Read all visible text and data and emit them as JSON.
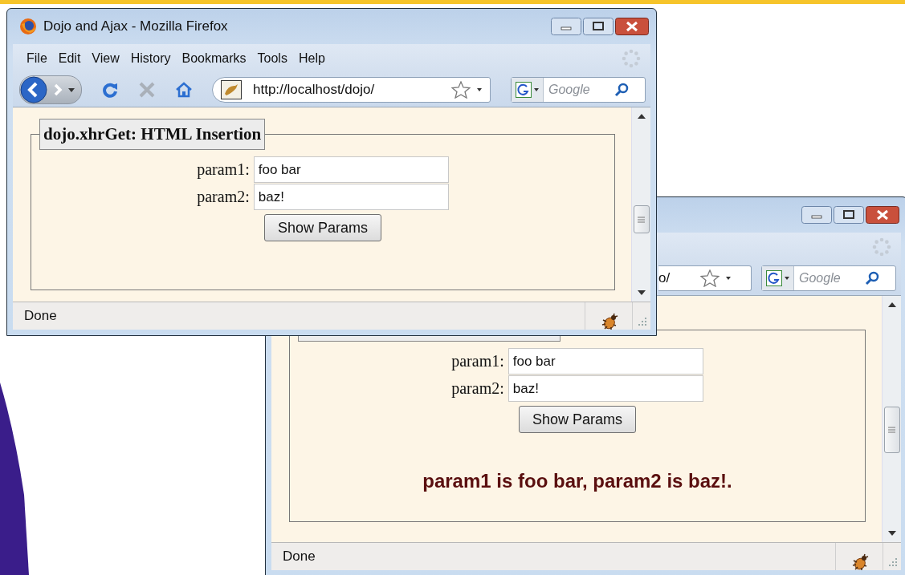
{
  "windows": [
    {
      "title": "Dojo and Ajax - Mozilla Firefox",
      "menu": [
        "File",
        "Edit",
        "View",
        "History",
        "Bookmarks",
        "Tools",
        "Help"
      ],
      "url": "http://localhost/dojo/",
      "search": {
        "placeholder": "Google"
      },
      "legend": "dojo.xhrGet: HTML Insertion",
      "fields": [
        {
          "label": "param1:",
          "value": "foo bar"
        },
        {
          "label": "param2:",
          "value": "baz!"
        }
      ],
      "button": "Show Params",
      "status": "Done"
    },
    {
      "url": "o/",
      "search": {
        "placeholder": "Google"
      },
      "fields": [
        {
          "label": "param1:",
          "value": "foo bar"
        },
        {
          "label": "param2:",
          "value": "baz!"
        }
      ],
      "button": "Show Params",
      "result": "param1 is foo bar, param2 is baz!.",
      "status": "Done"
    }
  ]
}
